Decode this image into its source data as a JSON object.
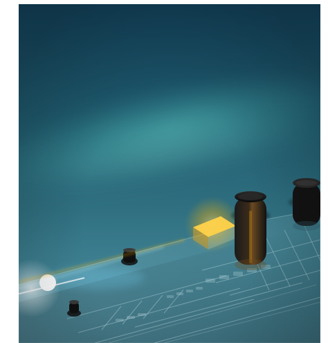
{
  "image": {
    "alt": "",
    "theme": {
      "background": "#1f5b6e",
      "accent": "#ffb400",
      "panel_line": "#cfe8ef",
      "knob_dark": "#111111"
    }
  }
}
